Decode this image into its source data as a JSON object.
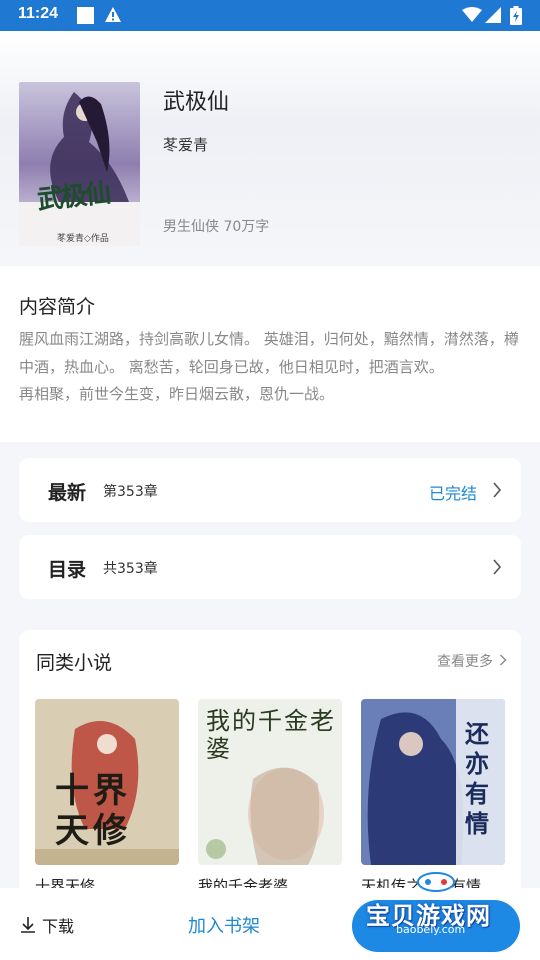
{
  "status_bar": {
    "time": "11:24"
  },
  "book": {
    "title": "武极仙",
    "author": "苳爱青",
    "meta": "男生仙侠 70万字",
    "cover_text": "武极仙",
    "cover_caption": "苳爱青◇作品"
  },
  "intro": {
    "heading": "内容简介",
    "text": "腥风血雨江湖路，持剑高歌儿女情。 英雄泪，归何处，黯然情，潸然落，樽中酒，热血心。 离愁苦，轮回身已故，他日相见时，把酒言欢。\n再相聚，前世今生变，昨日烟云散，恩仇一战。"
  },
  "latest": {
    "label": "最新",
    "chapter": "第353章",
    "status": "已完结"
  },
  "catalog": {
    "label": "目录",
    "count": "共353章"
  },
  "similar": {
    "heading": "同类小说",
    "more": "查看更多",
    "books": [
      {
        "name": "十界天修",
        "cover_text": "十界天修"
      },
      {
        "name": "我的千金老婆",
        "cover_text": "我的千金老婆"
      },
      {
        "name": "天机传之还亦有情",
        "cover_text": "还亦有情"
      }
    ]
  },
  "bottom": {
    "download": "下载",
    "add_shelf": "加入书架"
  },
  "watermark": {
    "title": "宝贝游戏网",
    "url": "baobeiy.com"
  }
}
